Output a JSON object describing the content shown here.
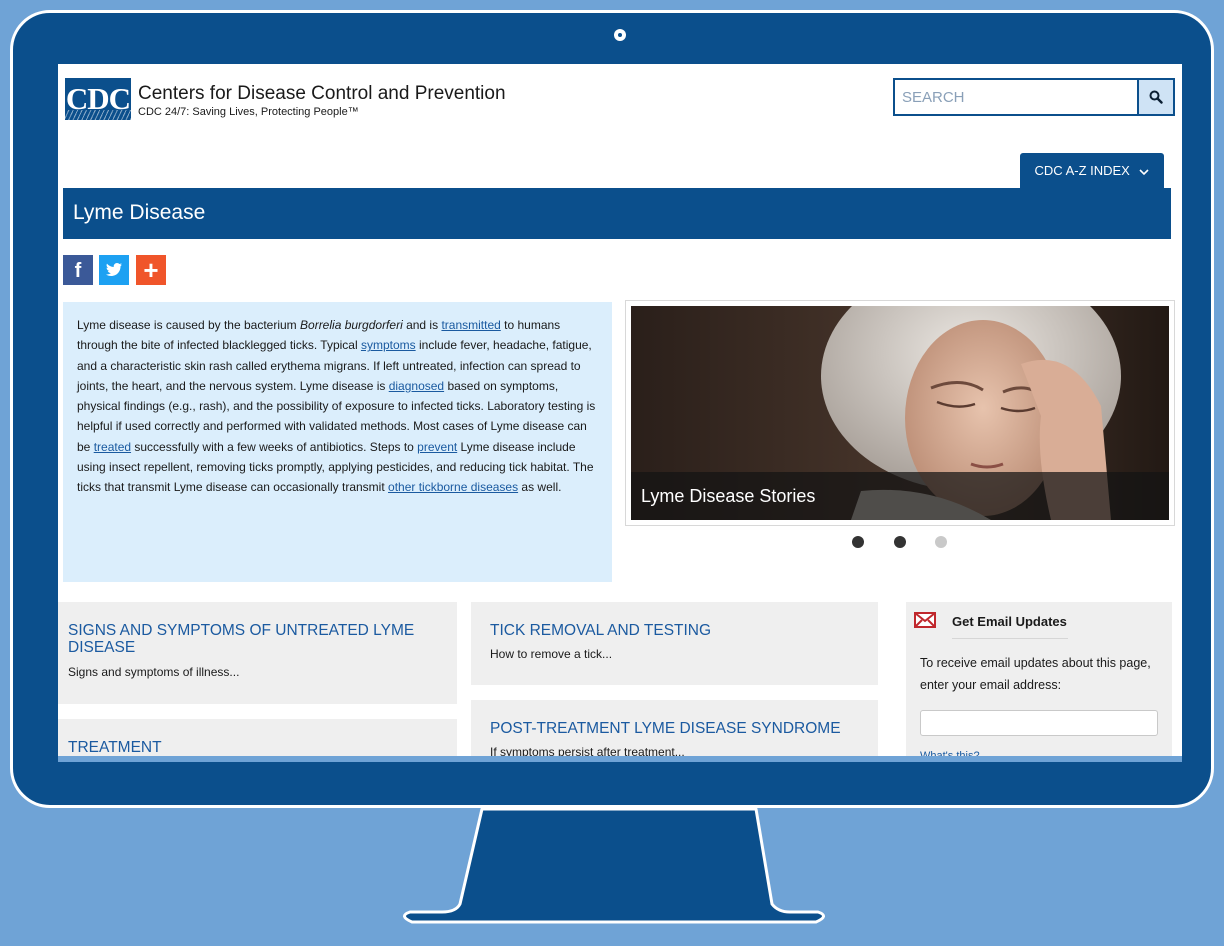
{
  "colors": {
    "background": "#6fa3d6",
    "monitor": "#0b4f8c",
    "cdc_blue": "#0b4f8c",
    "link": "#1a5aa0",
    "intro_bg": "#dbeefc",
    "card_bg": "#efefef"
  },
  "header": {
    "logo_text": "CDC",
    "org_name": "Centers for Disease Control and Prevention",
    "tagline": "CDC 24/7: Saving Lives, Protecting People™",
    "search_placeholder": "SEARCH",
    "search_icon": "search-icon",
    "az_index_label": "CDC A-Z INDEX",
    "az_icon": "chevron-down-icon"
  },
  "page": {
    "title": "Lyme Disease",
    "share_icons": [
      "facebook-icon",
      "twitter-icon",
      "plus-icon"
    ],
    "share_fb_glyph": "f"
  },
  "intro": {
    "t1": "Lyme disease is caused by the bacterium ",
    "italic": "Borrelia burgdorferi",
    "t2": " and is ",
    "link_transmitted": "transmitted",
    "t3": " to humans through the bite of infected blacklegged ticks. Typical ",
    "link_symptoms": "symptoms",
    "t4": " include fever, headache, fatigue, and a characteristic skin rash called erythema migrans. If left untreated, infection can spread to joints, the heart, and the nervous system. Lyme disease is ",
    "link_diagnosed": "diagnosed",
    "t5": " based on symptoms, physical findings (e.g., rash), and the possibility of exposure to infected ticks.  Laboratory testing is helpful if used correctly and performed with validated methods. Most cases of Lyme disease can be ",
    "link_treated": "treated",
    "t6": " successfully with a few weeks of antibiotics. Steps to ",
    "link_prevent": "prevent",
    "t7": " Lyme disease include using insect repellent, removing ticks promptly, applying pesticides, and reducing tick habitat. The ticks that transmit Lyme disease can occasionally transmit ",
    "link_other": "other tickborne diseases",
    "t8": " as well."
  },
  "carousel": {
    "caption": "Lyme Disease Stories",
    "active_slide": 2,
    "slide_count": 3
  },
  "cards": {
    "signs": {
      "title": "SIGNS AND SYMPTOMS OF UNTREATED LYME DISEASE",
      "desc": "Signs and symptoms of illness..."
    },
    "treatment": {
      "title": "TREATMENT"
    },
    "tick_removal": {
      "title": "TICK REMOVAL AND TESTING",
      "desc": "How to remove a tick..."
    },
    "ptlds": {
      "title": "POST-TREATMENT LYME DISEASE SYNDROME",
      "desc": "If symptoms persist after treatment..."
    }
  },
  "email": {
    "title": "Get Email Updates",
    "text": "To receive email updates about this page, enter your email address:",
    "icon": "envelope-icon",
    "link": "What's this?"
  }
}
